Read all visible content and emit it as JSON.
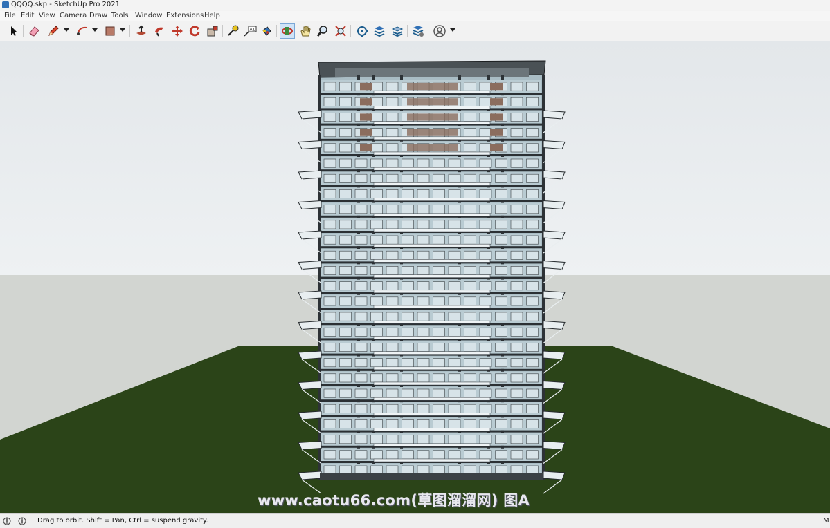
{
  "window": {
    "title": "QQQQ.skp - SketchUp Pro 2021"
  },
  "menu": {
    "items": [
      "File",
      "Edit",
      "View",
      "Camera",
      "Draw",
      "Tools",
      "Window",
      "Extensions",
      "Help"
    ]
  },
  "toolbar": {
    "tools": [
      "select-icon",
      "eraser-icon",
      "pencil-icon",
      "arc-icon",
      "rectangle-icon",
      "push-pull-icon",
      "follow-me-icon",
      "move-icon",
      "rotate-icon",
      "scale-icon",
      "tape-measure-icon",
      "text-icon",
      "paint-bucket-icon",
      "orbit-icon",
      "pan-icon",
      "zoom-icon",
      "zoom-extents-icon",
      "warehouse-icon",
      "extension-warehouse-icon",
      "layout-icon",
      "extension-manager-icon",
      "account-icon"
    ],
    "active_tool": "orbit-icon"
  },
  "viewport": {
    "watermark": "www.caotu66.com(草图溜溜网) 图A",
    "colors": {
      "sky_top": "#e3e7ea",
      "sky_bottom": "#eef1f3",
      "ground_plane": "#d2d5d1",
      "grass": "#2b4418"
    }
  },
  "status": {
    "message": "Drag to orbit. Shift = Pan, Ctrl = suspend gravity.",
    "right_label": "M"
  }
}
